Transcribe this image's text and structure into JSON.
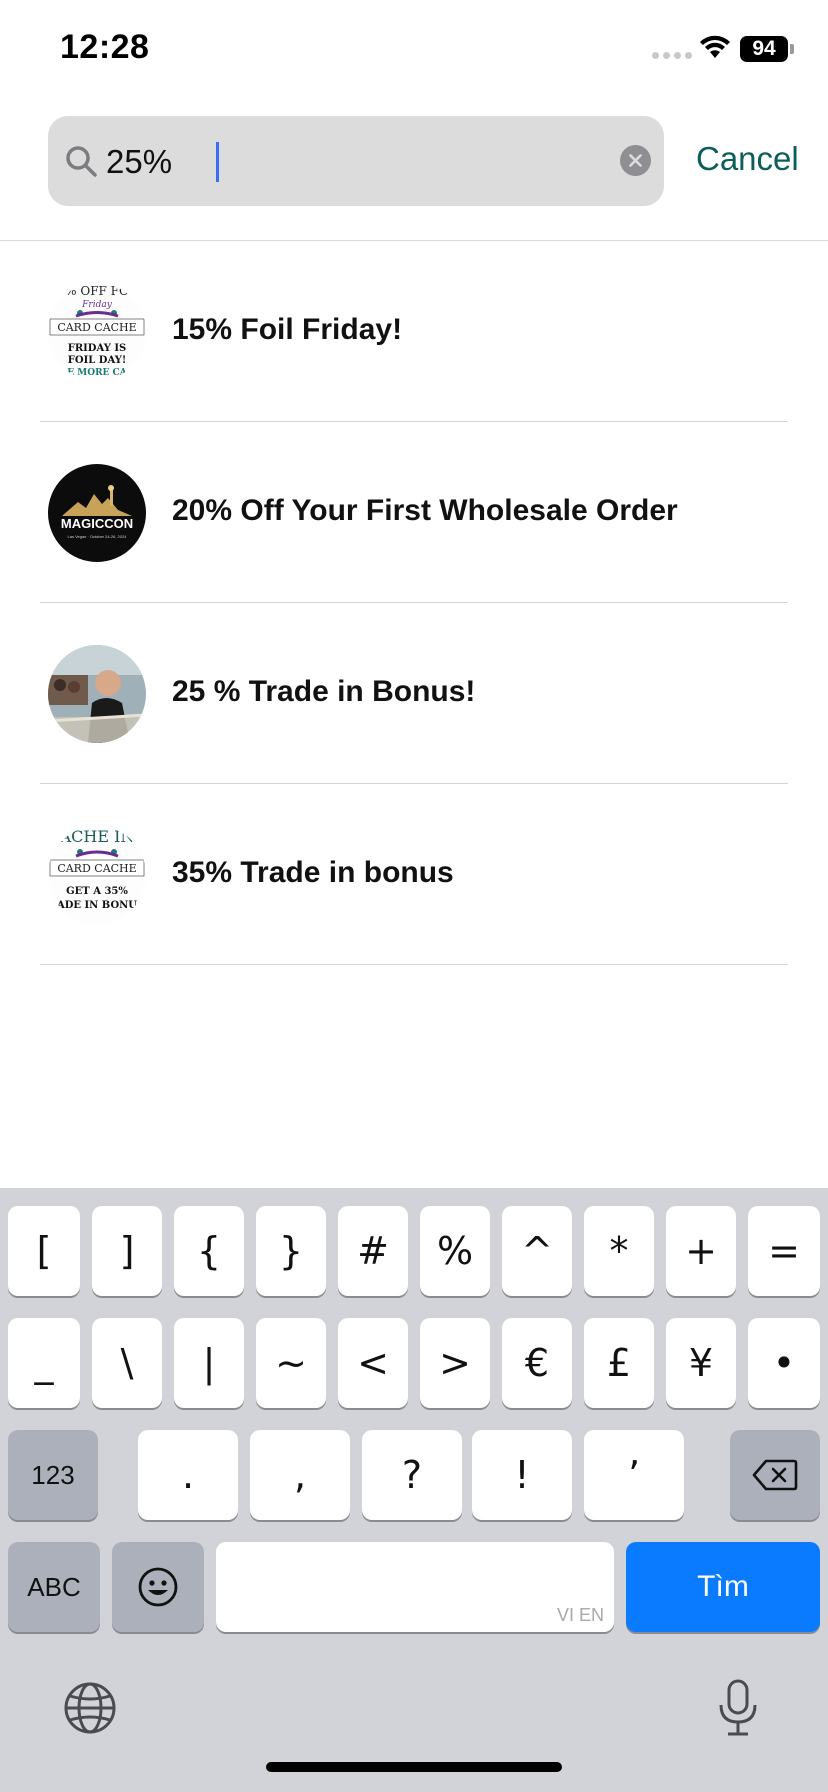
{
  "status_bar": {
    "time": "12:28",
    "battery": "94"
  },
  "search": {
    "value": "25%",
    "cancel_label": "Cancel"
  },
  "results": [
    {
      "title": "15% Foil Friday!",
      "logo_text": [
        "% OFF FO",
        "Friday",
        "CARD CACHE",
        "FRIDAY IS",
        "FOIL DAY!",
        "E MORE CA"
      ]
    },
    {
      "title": "20% Off Your First Wholesale Order",
      "logo_text": [
        "MAGICCON",
        "Las Vegas · October 24-26, 2024"
      ]
    },
    {
      "title": "25 % Trade in Bonus!"
    },
    {
      "title": "35% Trade in bonus",
      "logo_text": [
        "ACHE IN",
        "CARD CACHE",
        "GET A 35%",
        "ADE IN BONU"
      ]
    }
  ],
  "keyboard": {
    "row1": [
      "[",
      "]",
      "{",
      "}",
      "#",
      "%",
      "^",
      "*",
      "+",
      "="
    ],
    "row2": [
      "_",
      "\\",
      "|",
      "~",
      "<",
      ">",
      "€",
      "£",
      "¥",
      "•"
    ],
    "row3": [
      ".",
      ",",
      "?",
      "!",
      "’"
    ],
    "numbers_label": "123",
    "abc_label": "ABC",
    "space_hint": "VI EN",
    "go_label": "Tìm"
  }
}
